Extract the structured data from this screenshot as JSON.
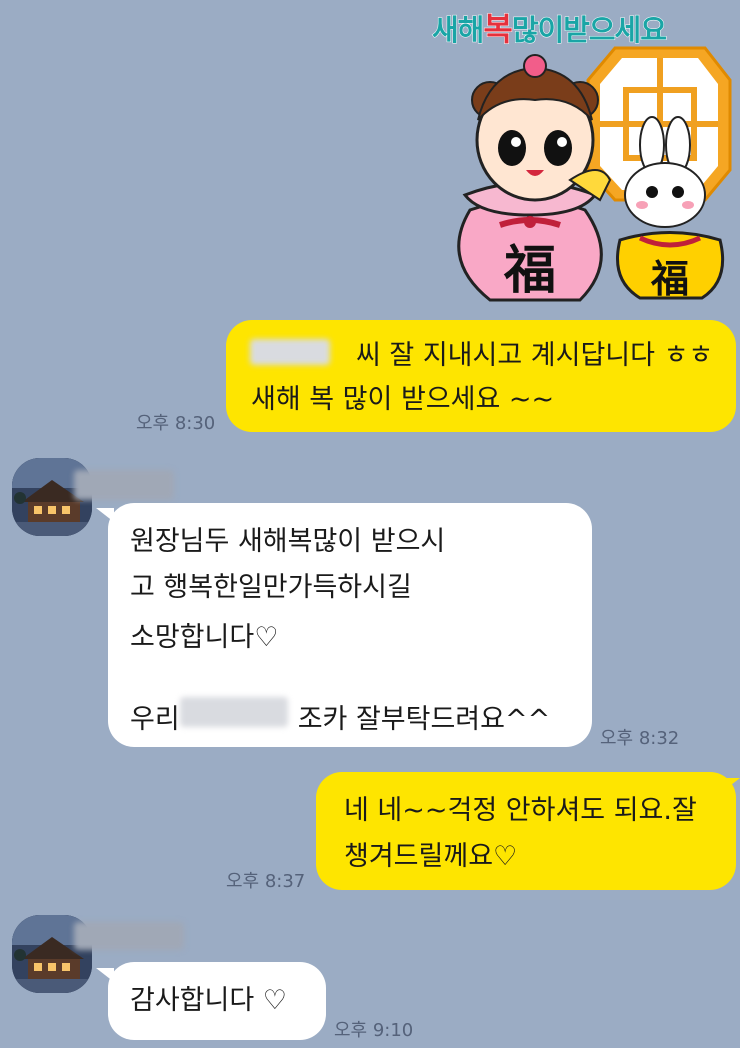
{
  "sticker": {
    "title_part1": "새해",
    "title_part2": "복",
    "title_part3": "많이받으세요",
    "glyph_large": "福",
    "glyph_small": "福"
  },
  "messages": [
    {
      "sender": "me",
      "lines": [
        "씨 잘 지내시고 계시답니다 ㅎㅎ",
        "새해 복 많이 받으세요 ~~"
      ],
      "time": "오후 8:30"
    },
    {
      "sender": "other",
      "lines": [
        "원장님두 새해복많이 받으시",
        "고  행복한일만가득하시길",
        "소망합니다♡",
        "",
        "우리",
        "조카 잘부탁드려요^^"
      ],
      "time": "오후 8:32"
    },
    {
      "sender": "me",
      "lines": [
        "네 네~~걱정 안하셔도 되요.잘",
        "챙겨드릴께요♡"
      ],
      "time": "오후 8:37"
    },
    {
      "sender": "other",
      "lines": [
        "감사합니다 ♡"
      ],
      "time": "오후 9:10"
    }
  ],
  "colors": {
    "background": "#9bacc4",
    "my_bubble": "#fee500",
    "other_bubble": "#ffffff",
    "title_teal": "#1aa5a6",
    "title_red": "#e6303c"
  },
  "icons": {
    "avatar": "building-photo-avatar"
  }
}
